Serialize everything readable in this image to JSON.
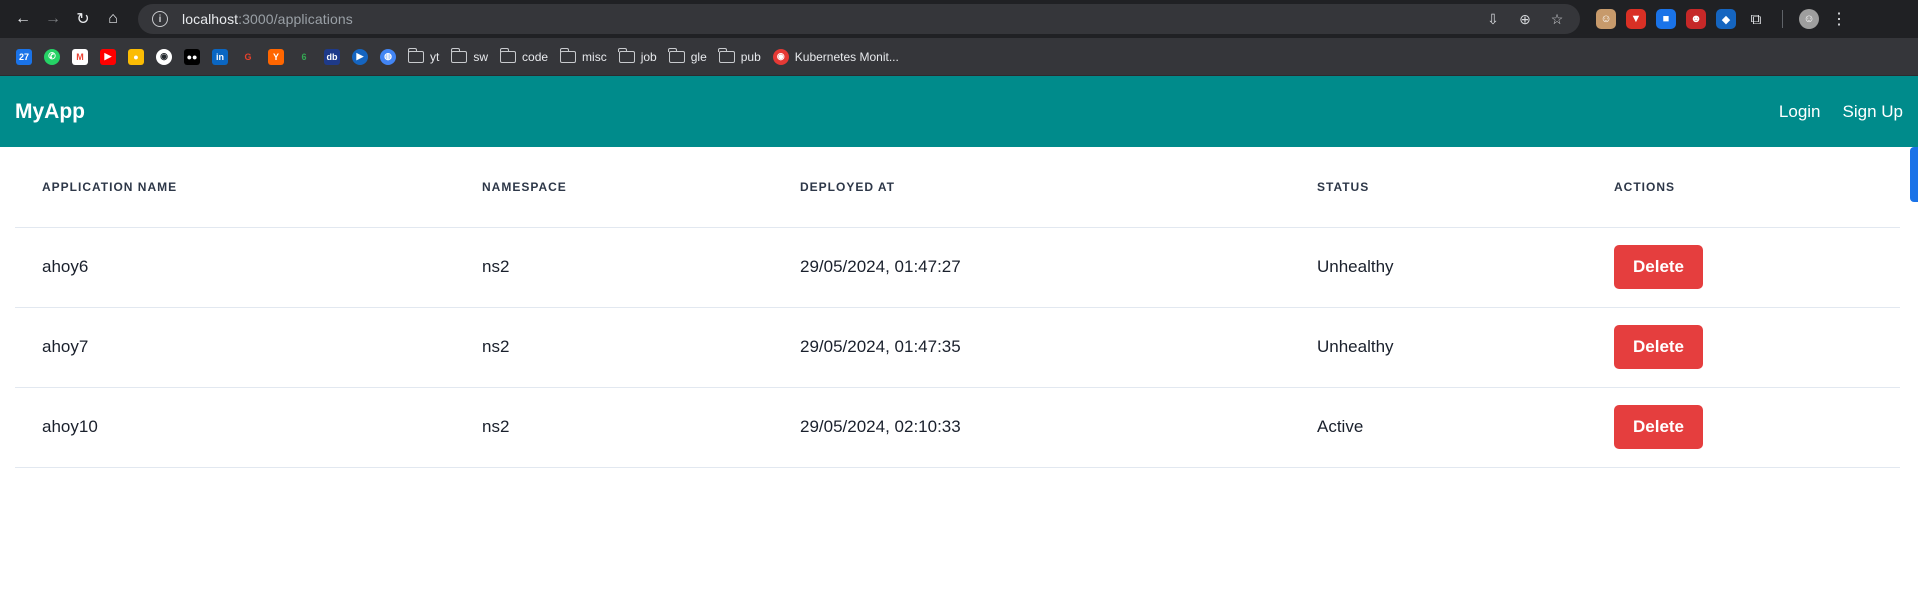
{
  "browser": {
    "url_host": "localhost",
    "url_path": ":3000/applications",
    "bookmarks": [
      {
        "type": "favicon",
        "icon": "calendar-icon",
        "color": "#1a73e8",
        "glyph": "27"
      },
      {
        "type": "favicon",
        "icon": "whatsapp-icon",
        "color": "#25d366",
        "glyph": "✆"
      },
      {
        "type": "favicon",
        "icon": "gmail-icon",
        "color": "#ea4335",
        "glyph": "M"
      },
      {
        "type": "favicon",
        "icon": "youtube-icon",
        "color": "#ff0000",
        "glyph": "▶"
      },
      {
        "type": "favicon",
        "icon": "keep-icon",
        "color": "#fbbc04",
        "glyph": "●"
      },
      {
        "type": "favicon",
        "icon": "github-icon",
        "color": "#24292e",
        "glyph": "◉"
      },
      {
        "type": "favicon",
        "icon": "medium-icon",
        "color": "#000000",
        "glyph": "●●"
      },
      {
        "type": "favicon",
        "icon": "linkedin-icon",
        "color": "#0a66c2",
        "glyph": "in"
      },
      {
        "type": "favicon",
        "icon": "codeforces-icon",
        "color": "#e8412b",
        "glyph": "G"
      },
      {
        "type": "favicon",
        "icon": "hackernews-icon",
        "color": "#ff6600",
        "glyph": "Y"
      },
      {
        "type": "favicon",
        "icon": "leaf-icon",
        "color": "#34a853",
        "glyph": "6"
      },
      {
        "type": "favicon",
        "icon": "db-icon",
        "color": "#1e3a8a",
        "glyph": "db"
      },
      {
        "type": "favicon",
        "icon": "play-icon",
        "color": "#1565c0",
        "glyph": "▶"
      },
      {
        "type": "favicon",
        "icon": "globe-icon",
        "color": "#4285f4",
        "glyph": "◍"
      }
    ],
    "folders": [
      {
        "label": "yt"
      },
      {
        "label": "sw"
      },
      {
        "label": "code"
      },
      {
        "label": "misc"
      },
      {
        "label": "job"
      },
      {
        "label": "gle"
      },
      {
        "label": "pub"
      }
    ],
    "k8s_bookmark": "Kubernetes Monit..."
  },
  "app": {
    "brand": "MyApp",
    "nav": {
      "login": "Login",
      "signup": "Sign Up"
    },
    "accent_color": "#008b8b",
    "danger_color": "#e53e3e"
  },
  "table": {
    "headers": {
      "name": "Application Name",
      "namespace": "Namespace",
      "deployed": "Deployed At",
      "status": "Status",
      "actions": "Actions"
    },
    "rows": [
      {
        "name": "ahoy6",
        "namespace": "ns2",
        "deployed": "29/05/2024, 01:47:27",
        "status": "Unhealthy",
        "action": "Delete"
      },
      {
        "name": "ahoy7",
        "namespace": "ns2",
        "deployed": "29/05/2024, 01:47:35",
        "status": "Unhealthy",
        "action": "Delete"
      },
      {
        "name": "ahoy10",
        "namespace": "ns2",
        "deployed": "29/05/2024, 02:10:33",
        "status": "Active",
        "action": "Delete"
      }
    ]
  }
}
